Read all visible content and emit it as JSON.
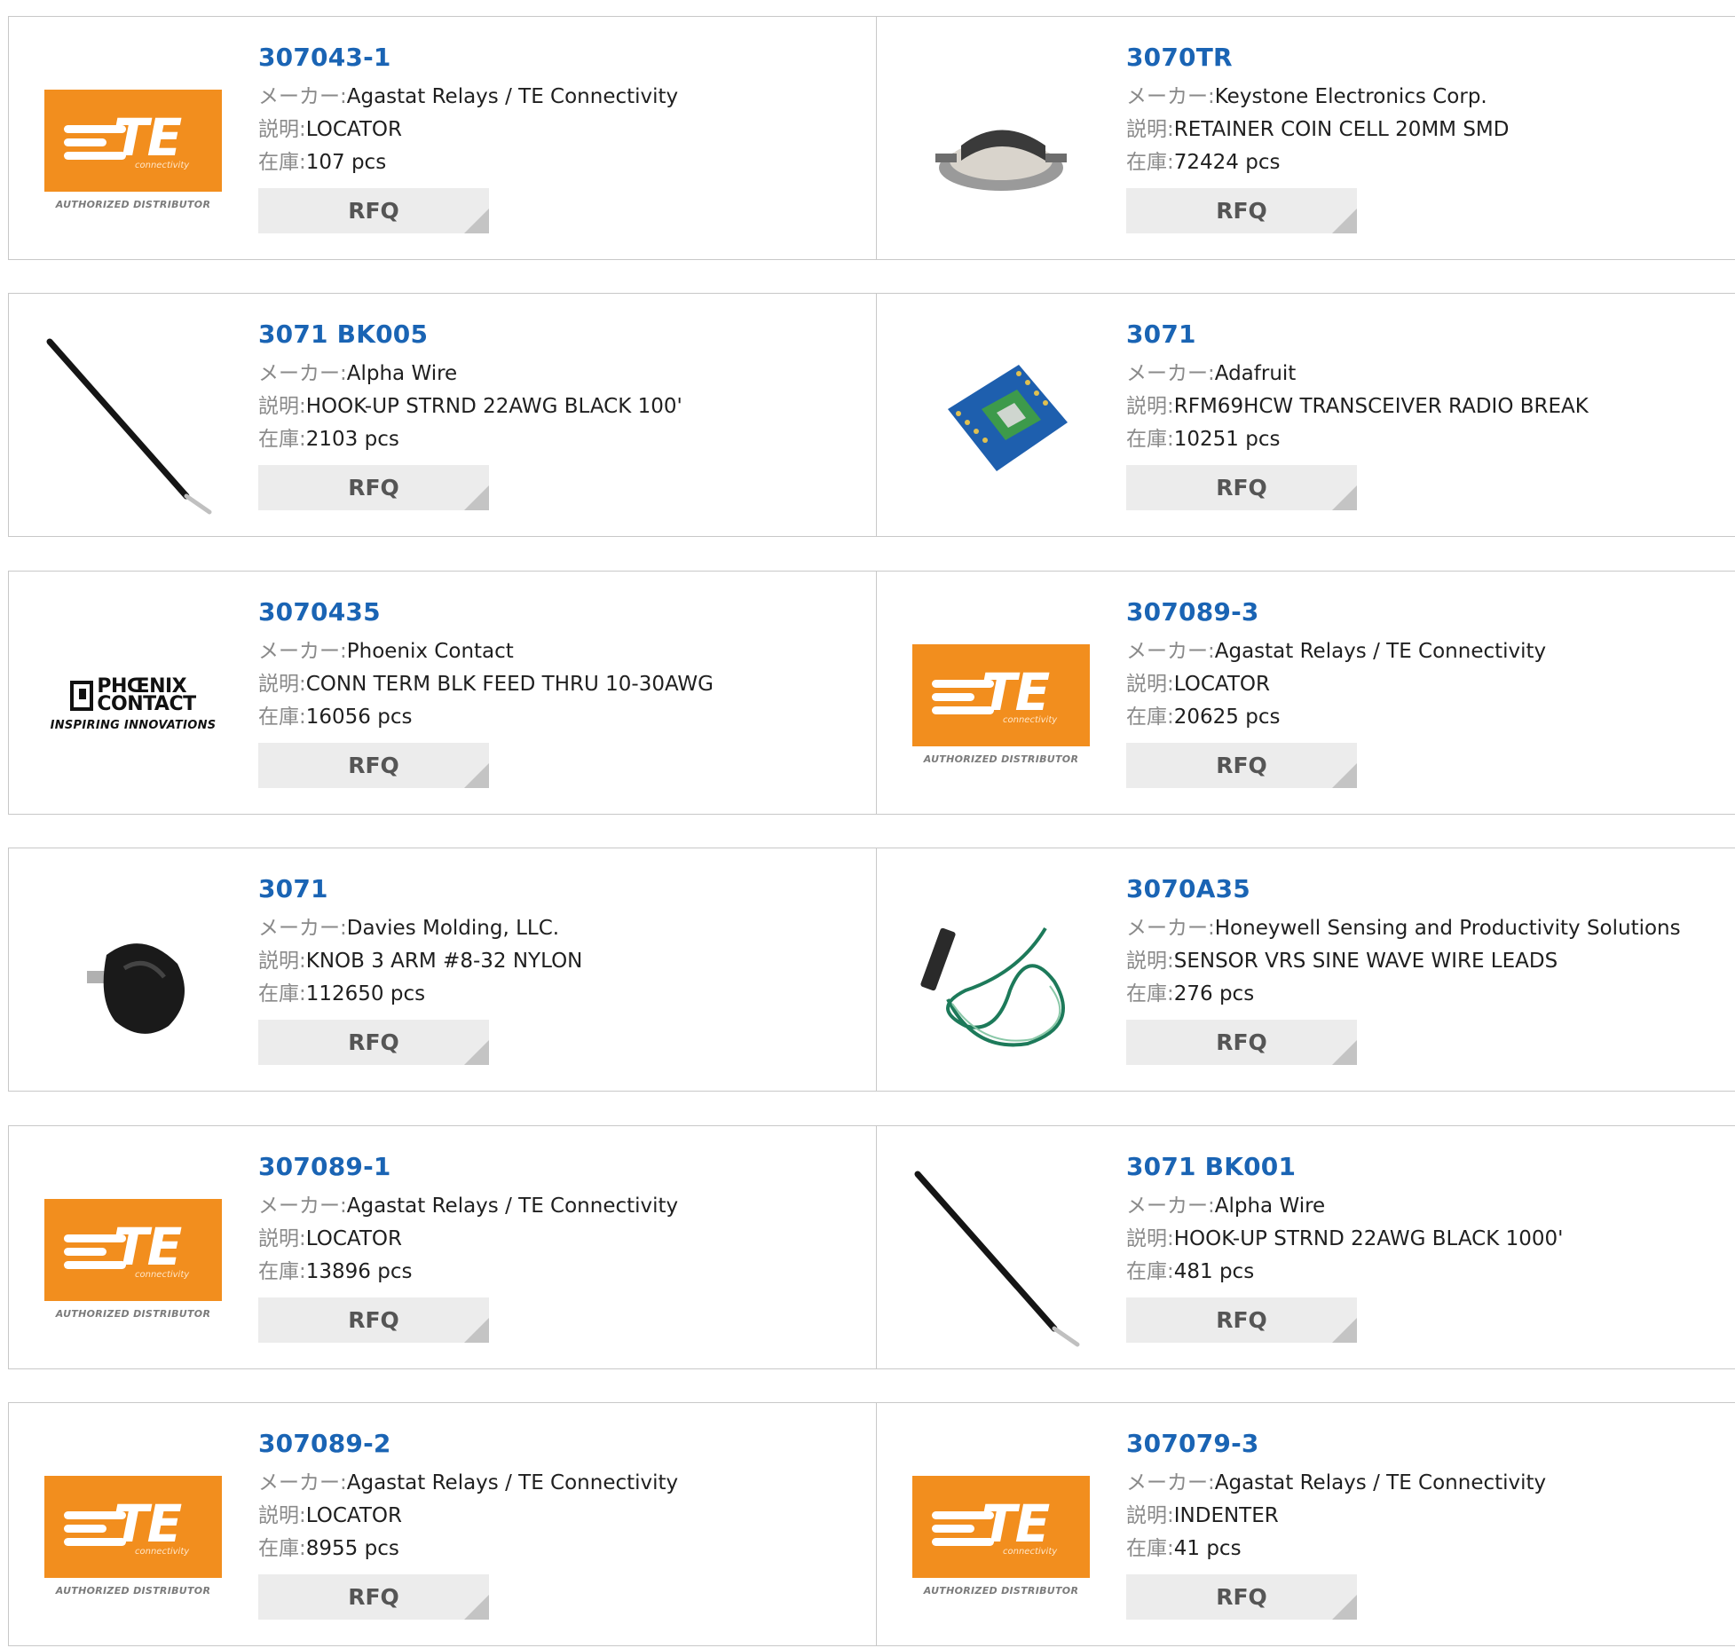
{
  "labels": {
    "maker": "メーカー:",
    "desc": "説明:",
    "stock": "在庫:",
    "rfq": "RFQ"
  },
  "logos": {
    "te": {
      "letters": "TE",
      "sub": "connectivity",
      "tagline": "AUTHORIZED DISTRIBUTOR"
    },
    "phoenix": {
      "line1": "PHŒNIX",
      "line2": "CONTACT",
      "tagline": "INSPIRING INNOVATIONS"
    }
  },
  "colors": {
    "link": "#1a64b4",
    "te_orange": "#f28e1e",
    "rfq_bg": "#ececec"
  },
  "products": [
    {
      "pn": "307043-1",
      "maker": "Agastat Relays / TE Connectivity",
      "desc": "LOCATOR",
      "stock": "107 pcs",
      "image": "te-logo"
    },
    {
      "pn": "3070TR",
      "maker": "Keystone Electronics Corp.",
      "desc": "RETAINER COIN CELL 20MM SMD",
      "stock": "72424 pcs",
      "image": "coin-cell-holder-photo"
    },
    {
      "pn": "3071 BK005",
      "maker": "Alpha Wire",
      "desc": "HOOK-UP STRND 22AWG BLACK 100'",
      "stock": "2103 pcs",
      "image": "black-wire-photo"
    },
    {
      "pn": "3071",
      "maker": "Adafruit",
      "desc": "RFM69HCW TRANSCEIVER RADIO BREAK",
      "stock": "10251 pcs",
      "image": "radio-board-photo"
    },
    {
      "pn": "3070435",
      "maker": "Phoenix Contact",
      "desc": "CONN TERM BLK FEED THRU 10-30AWG",
      "stock": "16056 pcs",
      "image": "phoenix-logo"
    },
    {
      "pn": "307089-3",
      "maker": "Agastat Relays / TE Connectivity",
      "desc": "LOCATOR",
      "stock": "20625 pcs",
      "image": "te-logo"
    },
    {
      "pn": "3071",
      "maker": "Davies Molding, LLC.",
      "desc": "KNOB 3 ARM #8-32 NYLON",
      "stock": "112650 pcs",
      "image": "knob-photo"
    },
    {
      "pn": "3070A35",
      "maker": "Honeywell Sensing and Productivity Solutions",
      "desc": "SENSOR VRS SINE WAVE WIRE LEADS",
      "stock": "276 pcs",
      "image": "sensor-leads-photo"
    },
    {
      "pn": "307089-1",
      "maker": "Agastat Relays / TE Connectivity",
      "desc": "LOCATOR",
      "stock": "13896 pcs",
      "image": "te-logo"
    },
    {
      "pn": "3071 BK001",
      "maker": "Alpha Wire",
      "desc": "HOOK-UP STRND 22AWG BLACK 1000'",
      "stock": "481 pcs",
      "image": "black-wire-photo"
    },
    {
      "pn": "307089-2",
      "maker": "Agastat Relays / TE Connectivity",
      "desc": "LOCATOR",
      "stock": "8955 pcs",
      "image": "te-logo"
    },
    {
      "pn": "307079-3",
      "maker": "Agastat Relays / TE Connectivity",
      "desc": "INDENTER",
      "stock": "41 pcs",
      "image": "te-logo"
    }
  ]
}
